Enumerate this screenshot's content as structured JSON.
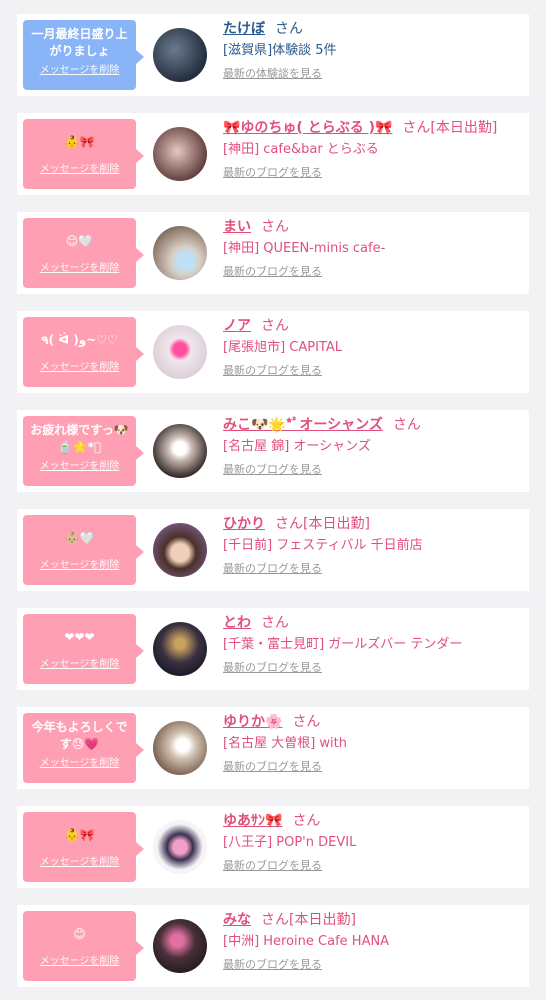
{
  "delete_label": "メッセージを削除",
  "colors": {
    "pink": "#ff9fb4",
    "blue": "#8ab4f8",
    "name_pink": "#e0507a",
    "name_blue": "#2b5a8c"
  },
  "items": [
    {
      "message": "一月最終日盛り上がりましょ",
      "bubble_color": "blue",
      "name": "たけぼ",
      "suffix": "さん",
      "location": "[滋賀県]体験談 5件",
      "link": "最新の体験談を見る"
    },
    {
      "message": "👶🎀",
      "bubble_color": "pink",
      "name": "🎀ゆのちゅ( とらぶる )🎀",
      "suffix": "さん[本日出勤]",
      "location": "[神田] cafe&bar とらぶる",
      "link": "最新のブログを見る"
    },
    {
      "message": "😌🤍",
      "bubble_color": "pink",
      "name": "まい",
      "suffix": "さん",
      "location": "[神田] QUEEN-minis cafe-",
      "link": "最新のブログを見る"
    },
    {
      "message": "٩( ᐛ )و~♡♡",
      "bubble_color": "pink",
      "name": "ノア",
      "suffix": "さん",
      "location": "[尾張旭市] CAPITAL",
      "link": "最新のブログを見る"
    },
    {
      "message": "お疲れ様ですっ🐶🍵🌟*ﾟ",
      "bubble_color": "pink",
      "name": "みこ🐶🌟*ﾟオーシャンズ",
      "suffix": "さん",
      "location": "[名古屋 錦] オーシャンズ",
      "link": "最新のブログを見る"
    },
    {
      "message": "👶🏼🤍",
      "bubble_color": "pink",
      "name": "ひかり",
      "suffix": "さん[本日出勤]",
      "location": "[千日前] フェスティバル 千日前店",
      "link": "最新のブログを見る"
    },
    {
      "message": "❤❤❤",
      "bubble_color": "pink",
      "name": "とわ",
      "suffix": "さん",
      "location": "[千葉・富士見町] ガールズバー テンダー",
      "link": "最新のブログを見る"
    },
    {
      "message": "今年もよろしくです😓💗",
      "bubble_color": "pink",
      "name": "ゆりか🌸",
      "suffix": "さん",
      "location": "[名古屋 大曽根] with",
      "link": "最新のブログを見る"
    },
    {
      "message": "👶🎀",
      "bubble_color": "pink",
      "name": "ゆあｻﾝ🎀",
      "suffix": "さん",
      "location": "[八王子] POP'n DEVIL",
      "link": "最新のブログを見る"
    },
    {
      "message": "😊",
      "bubble_color": "pink",
      "name": "みな",
      "suffix": "さん[本日出勤]",
      "location": "[中洲] Heroine Cafe HANA",
      "link": "最新のブログを見る"
    }
  ]
}
